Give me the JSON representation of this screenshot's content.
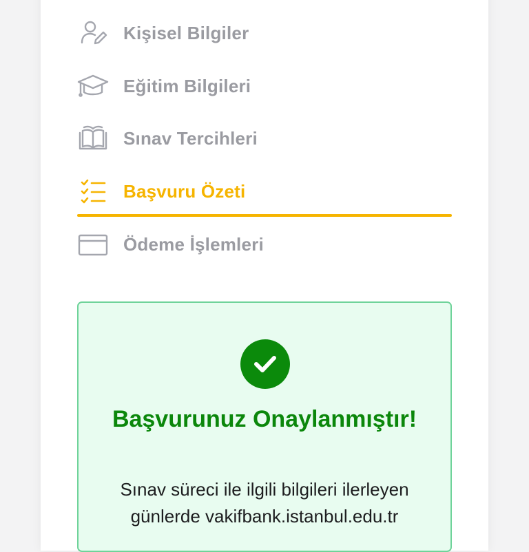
{
  "steps": [
    {
      "label": "Kişisel Bilgiler",
      "icon": "user-edit-icon",
      "active": false
    },
    {
      "label": "Eğitim Bilgileri",
      "icon": "graduation-cap-icon",
      "active": false
    },
    {
      "label": "Sınav Tercihleri",
      "icon": "open-book-icon",
      "active": false
    },
    {
      "label": "Başvuru Özeti",
      "icon": "checklist-icon",
      "active": true
    },
    {
      "label": "Ödeme İşlemleri",
      "icon": "credit-card-icon",
      "active": false
    }
  ],
  "success": {
    "icon": "check-circle-icon",
    "title": "Başvurunuz Onaylanmıştır!",
    "line1": "Sınav süreci ile ilgili bilgileri ilerleyen",
    "line2": "günlerde vakifbank.istanbul.edu.tr"
  },
  "colors": {
    "active": "#f6b400",
    "inactive": "#9a9ba1",
    "success_green": "#0b870b",
    "success_bg": "#e8fcf0",
    "success_border": "#6fd39a"
  }
}
